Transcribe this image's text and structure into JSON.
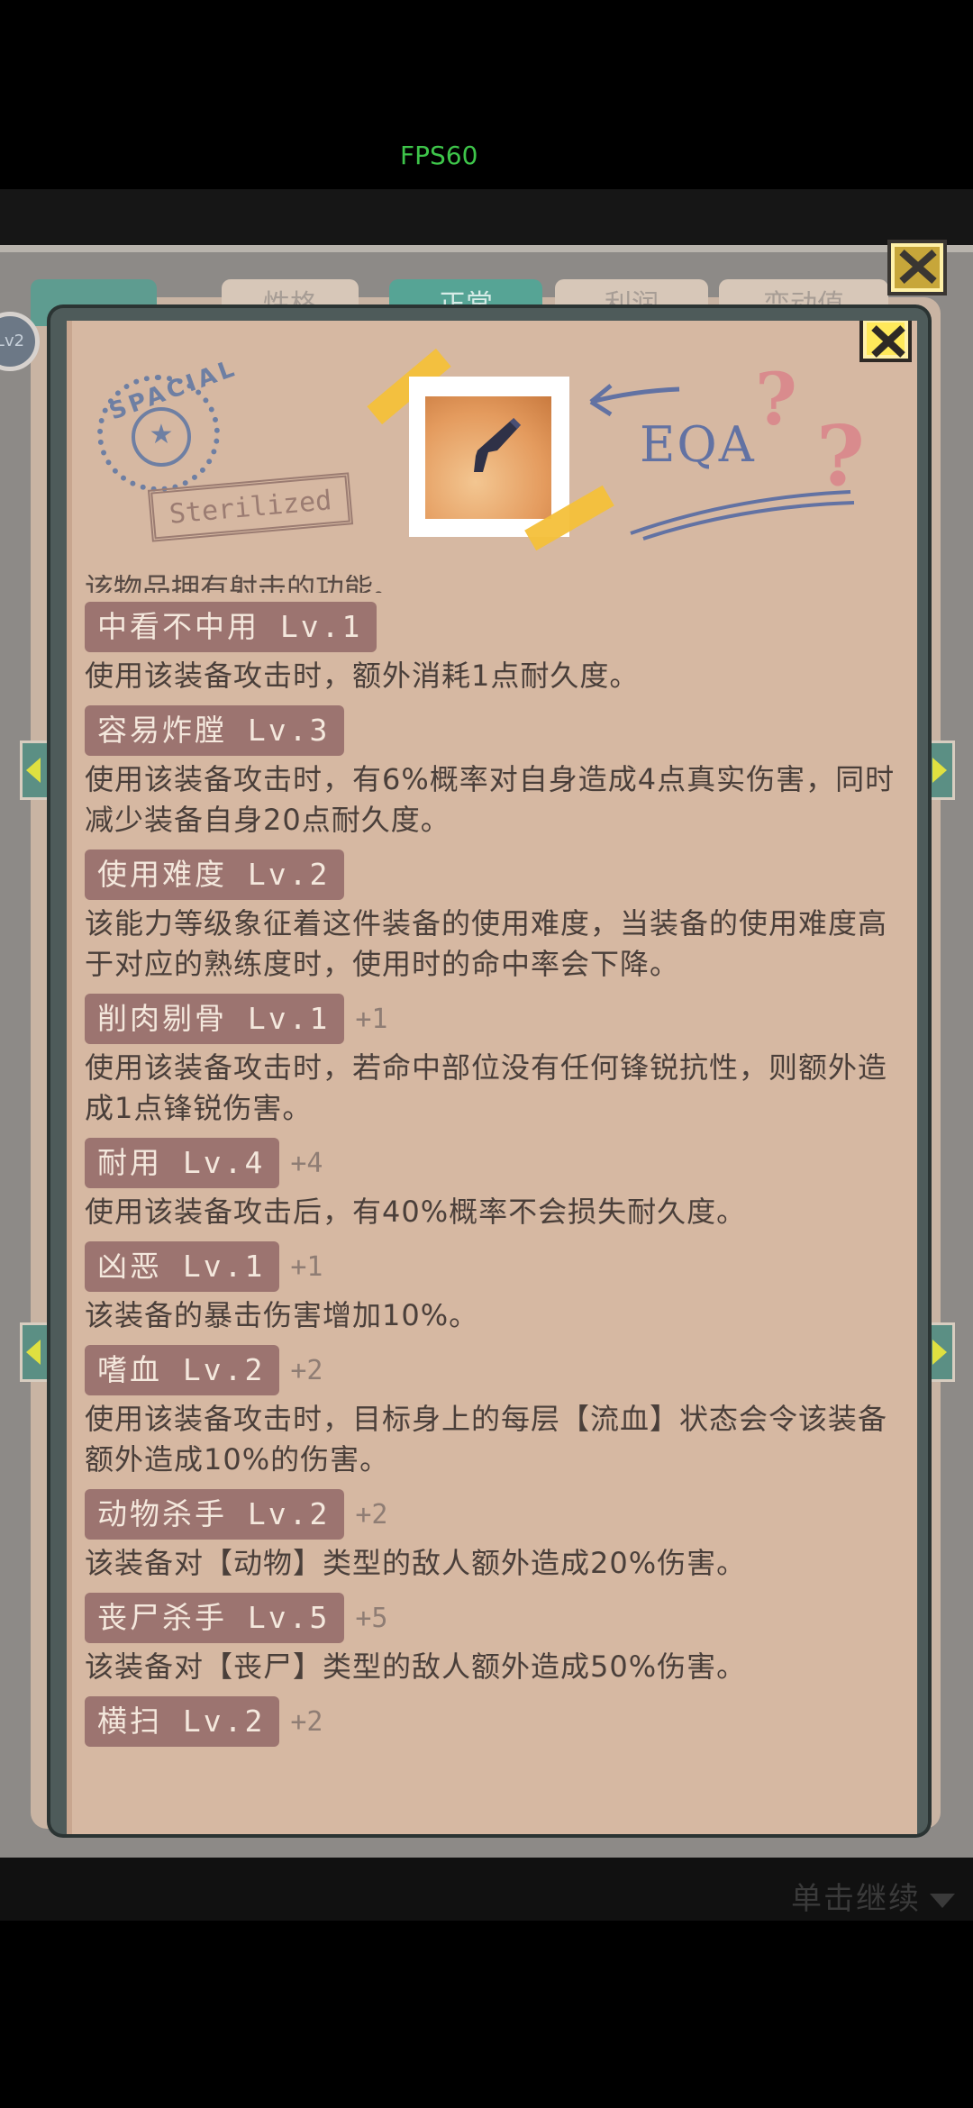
{
  "fps": "FPS60",
  "background_tabs": [
    "",
    "性格",
    "正常",
    "利润",
    "变动值"
  ],
  "background_badge": "Lv2",
  "footer": {
    "continue_label": "单击继续"
  },
  "header": {
    "stamp_text": "SPACIAL",
    "stamp_star": "★",
    "sterilized": "Sterilized",
    "eqa": "EQA",
    "qmarks": [
      "?",
      "?"
    ]
  },
  "cutoff_text": "该物品拥有射击的功能。",
  "abilities": [
    {
      "name": "中看不中用 Lv.1",
      "bonus": "",
      "desc": "使用该装备攻击时，额外消耗1点耐久度。"
    },
    {
      "name": "容易炸膛 Lv.3",
      "bonus": "",
      "desc": "使用该装备攻击时，有6%概率对自身造成4点真实伤害，同时减少装备自身20点耐久度。"
    },
    {
      "name": "使用难度 Lv.2",
      "bonus": "",
      "desc": "该能力等级象征着这件装备的使用难度，当装备的使用难度高于对应的熟练度时，使用时的命中率会下降。"
    },
    {
      "name": "削肉剔骨 Lv.1",
      "bonus": "+1",
      "desc": "使用该装备攻击时，若命中部位没有任何锋锐抗性，则额外造成1点锋锐伤害。"
    },
    {
      "name": "耐用 Lv.4",
      "bonus": "+4",
      "desc": "使用该装备攻击后，有40%概率不会损失耐久度。"
    },
    {
      "name": "凶恶 Lv.1",
      "bonus": "+1",
      "desc": "该装备的暴击伤害增加10%。"
    },
    {
      "name": "嗜血 Lv.2",
      "bonus": "+2",
      "desc": "使用该装备攻击时，目标身上的每层【流血】状态会令该装备额外造成10%的伤害。"
    },
    {
      "name": "动物杀手 Lv.2",
      "bonus": "+2",
      "desc": "该装备对【动物】类型的敌人额外造成20%伤害。"
    },
    {
      "name": "丧尸杀手 Lv.5",
      "bonus": "+5",
      "desc": "该装备对【丧尸】类型的敌人额外造成50%伤害。"
    },
    {
      "name": "横扫 Lv.2",
      "bonus": "+2",
      "desc": ""
    }
  ],
  "colors": {
    "accent_pill": "#9c7470",
    "paper": "#d6b8a2",
    "fps_green": "#3ec54a",
    "close_yellow": "#ffe95a"
  },
  "icons": {
    "close": "close-x-icon",
    "item": "pistol-icon"
  }
}
